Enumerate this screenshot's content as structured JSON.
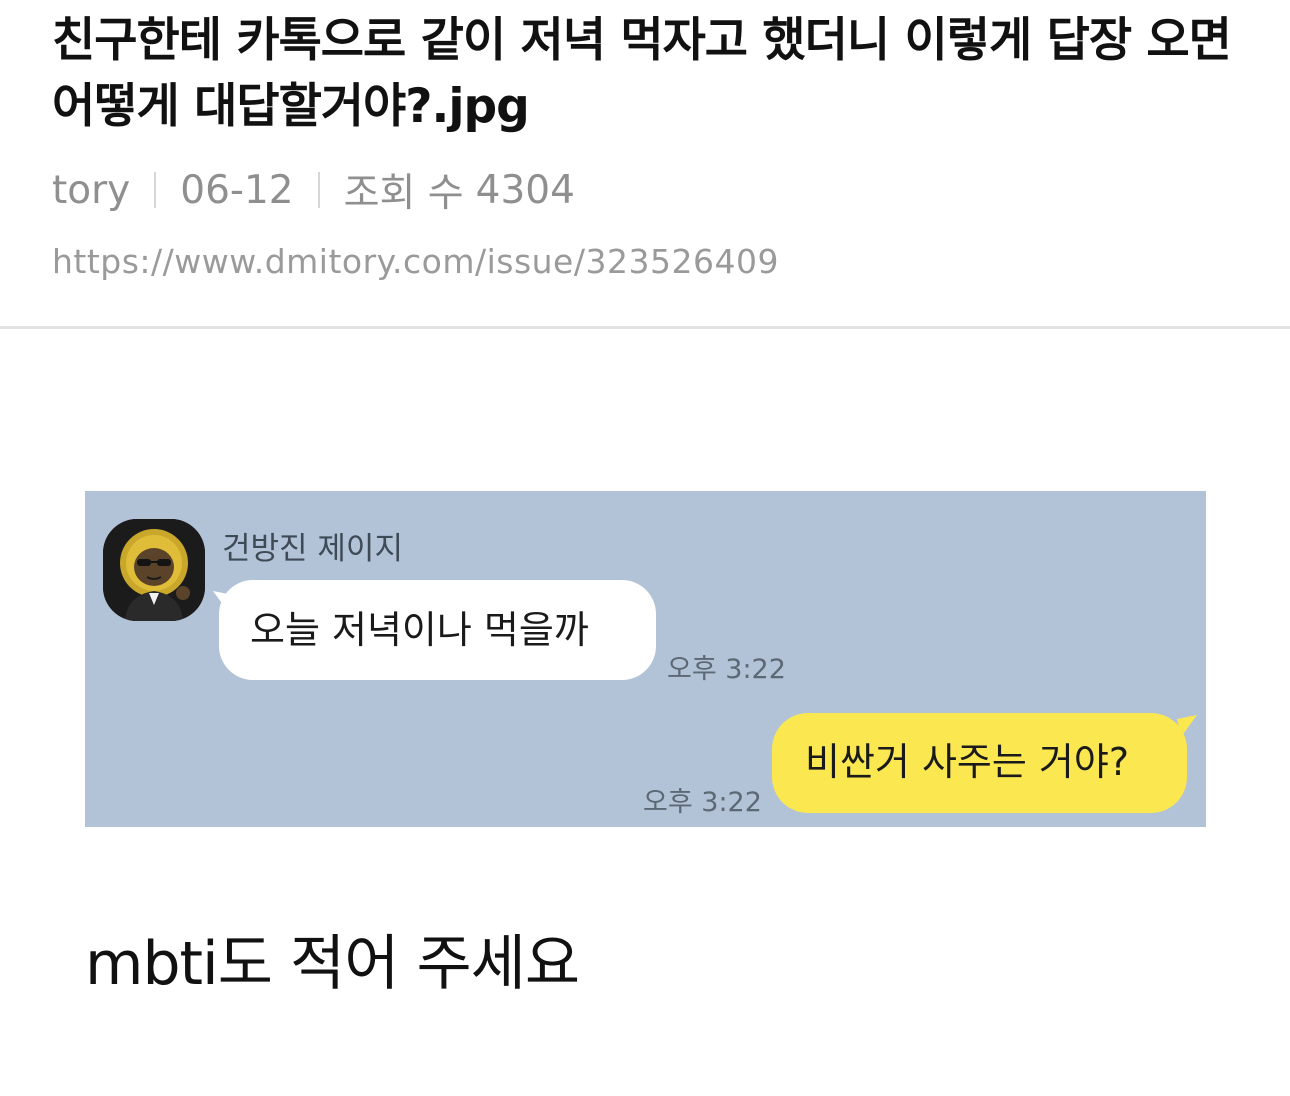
{
  "post": {
    "title": "친구한테 카톡으로 같이 저녁 먹자고 했더니 이렇게 답장 오면 어떻게 대답할거야?.jpg",
    "author": "tory",
    "date": "06-12",
    "views_label": "조회 수",
    "views": "4304",
    "url": "https://www.dmitory.com/issue/323526409"
  },
  "chat": {
    "sender_name": "건방진 제이지",
    "messages": [
      {
        "direction": "incoming",
        "text": "오늘 저녁이나 먹을까",
        "time": "오후 3:22",
        "bubble_color": "#ffffff"
      },
      {
        "direction": "outgoing",
        "text": "비싼거 사주는 거야?",
        "time": "오후 3:22",
        "bubble_color": "#fbe74f"
      }
    ],
    "background_color": "#b2c3d7",
    "avatar_icon": "jay-g-character-icon"
  },
  "body": {
    "caption": "mbti도 적어 주세요"
  }
}
